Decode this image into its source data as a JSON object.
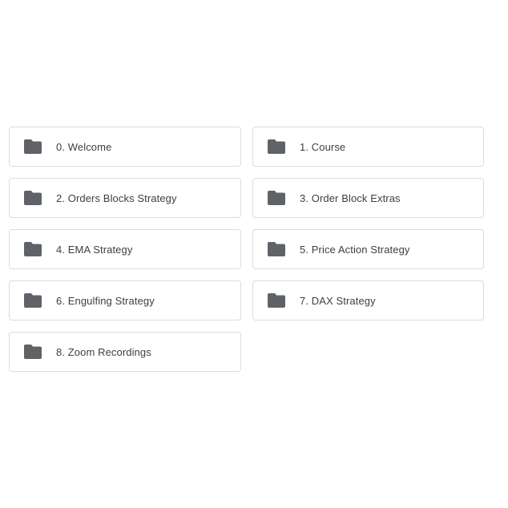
{
  "folders": [
    {
      "label": "0. Welcome",
      "icon": "folder-icon"
    },
    {
      "label": "1. Course",
      "icon": "folder-icon"
    },
    {
      "label": "2. Orders Blocks Strategy",
      "icon": "folder-icon"
    },
    {
      "label": "3. Order Block Extras",
      "icon": "folder-icon"
    },
    {
      "label": "4. EMA Strategy",
      "icon": "folder-icon"
    },
    {
      "label": "5. Price Action Strategy",
      "icon": "folder-icon"
    },
    {
      "label": "6. Engulfing Strategy",
      "icon": "folder-icon"
    },
    {
      "label": "7. DAX Strategy",
      "icon": "folder-icon"
    },
    {
      "label": "8. Zoom Recordings",
      "icon": "folder-icon"
    }
  ],
  "colors": {
    "icon": "#5f6368",
    "text": "#3c4043",
    "border": "#dadce0",
    "background": "#ffffff"
  }
}
